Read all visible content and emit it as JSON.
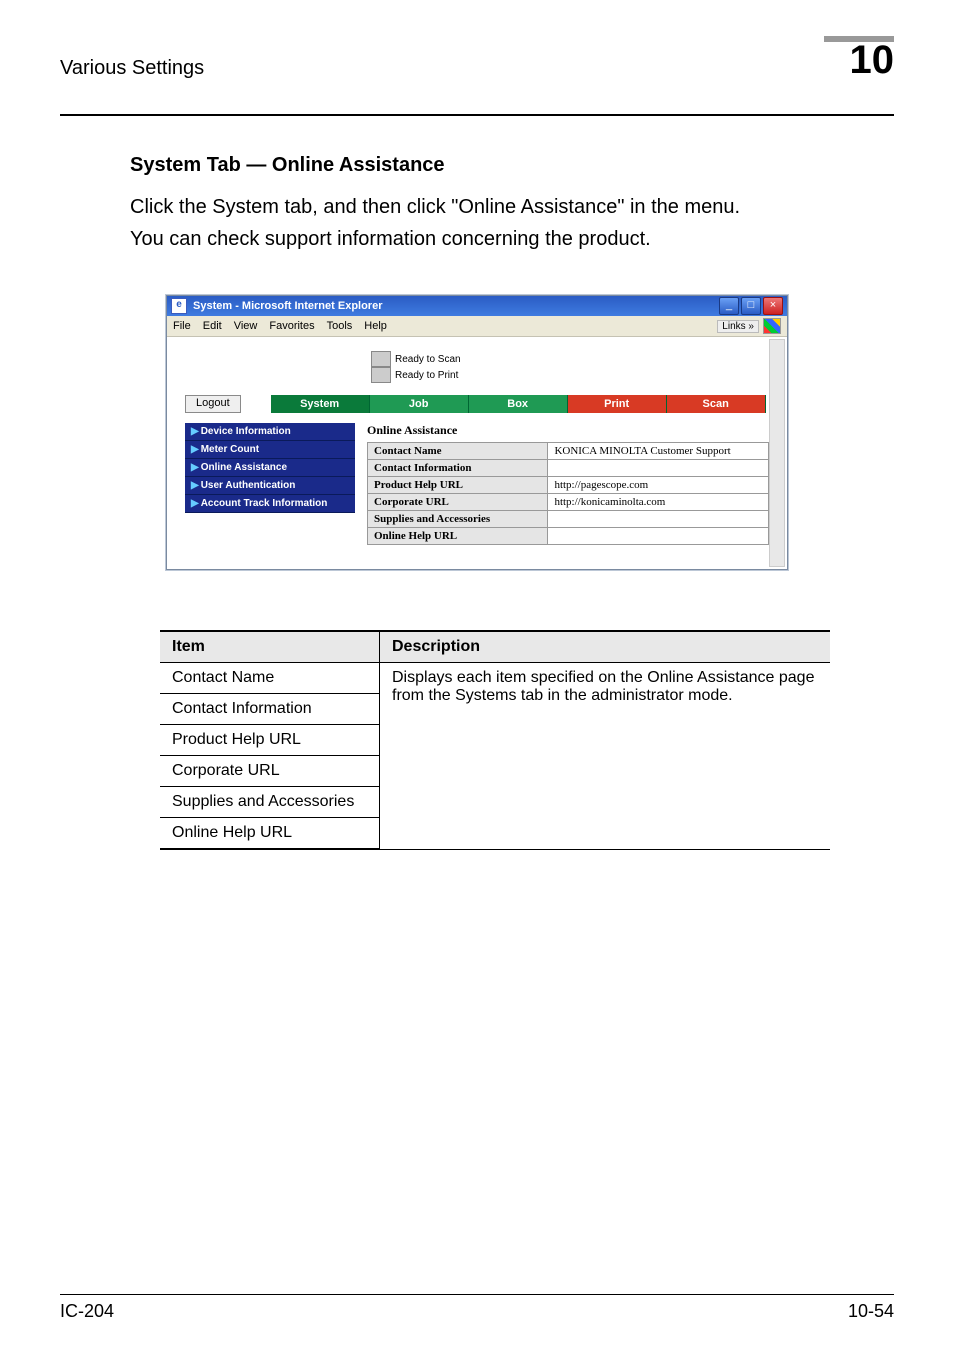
{
  "header": {
    "title": "Various Settings",
    "chapter_number": "10"
  },
  "section": {
    "heading": "System Tab — Online Assistance",
    "para1": "Click the System tab, and then click \"Online Assistance\" in the menu.",
    "para2": "You can check support information concerning the product."
  },
  "screenshot": {
    "window_title": "System - Microsoft Internet Explorer",
    "menubar": [
      "File",
      "Edit",
      "View",
      "Favorites",
      "Tools",
      "Help"
    ],
    "links_label": "Links",
    "status": {
      "scan": "Ready to Scan",
      "print": "Ready to Print"
    },
    "logout_label": "Logout",
    "tabs": {
      "system": "System",
      "job": "Job",
      "box": "Box",
      "print": "Print",
      "scan": "Scan"
    },
    "sidebar": {
      "items": [
        {
          "label": "Device Information"
        },
        {
          "label": "Meter Count"
        },
        {
          "label": "Online Assistance"
        },
        {
          "label": "User Authentication"
        },
        {
          "label": "Account Track Information"
        }
      ]
    },
    "panel": {
      "title": "Online Assistance",
      "rows": [
        {
          "label": "Contact Name",
          "value": "KONICA MINOLTA Customer Support"
        },
        {
          "label": "Contact Information",
          "value": ""
        },
        {
          "label": "Product Help URL",
          "value": "http://pagescope.com"
        },
        {
          "label": "Corporate URL",
          "value": "http://konicaminolta.com"
        },
        {
          "label": "Supplies and Accessories",
          "value": ""
        },
        {
          "label": "Online Help URL",
          "value": ""
        }
      ]
    }
  },
  "desc_table": {
    "headers": {
      "item": "Item",
      "description": "Description"
    },
    "shared_description": "Displays each item specified on the Online Assistance page from the Systems tab in the administrator mode.",
    "items": [
      "Contact Name",
      "Contact Information",
      "Product Help URL",
      "Corporate URL",
      "Supplies and Accessories",
      "Online Help URL"
    ]
  },
  "footer": {
    "left": "IC-204",
    "right": "10-54"
  }
}
